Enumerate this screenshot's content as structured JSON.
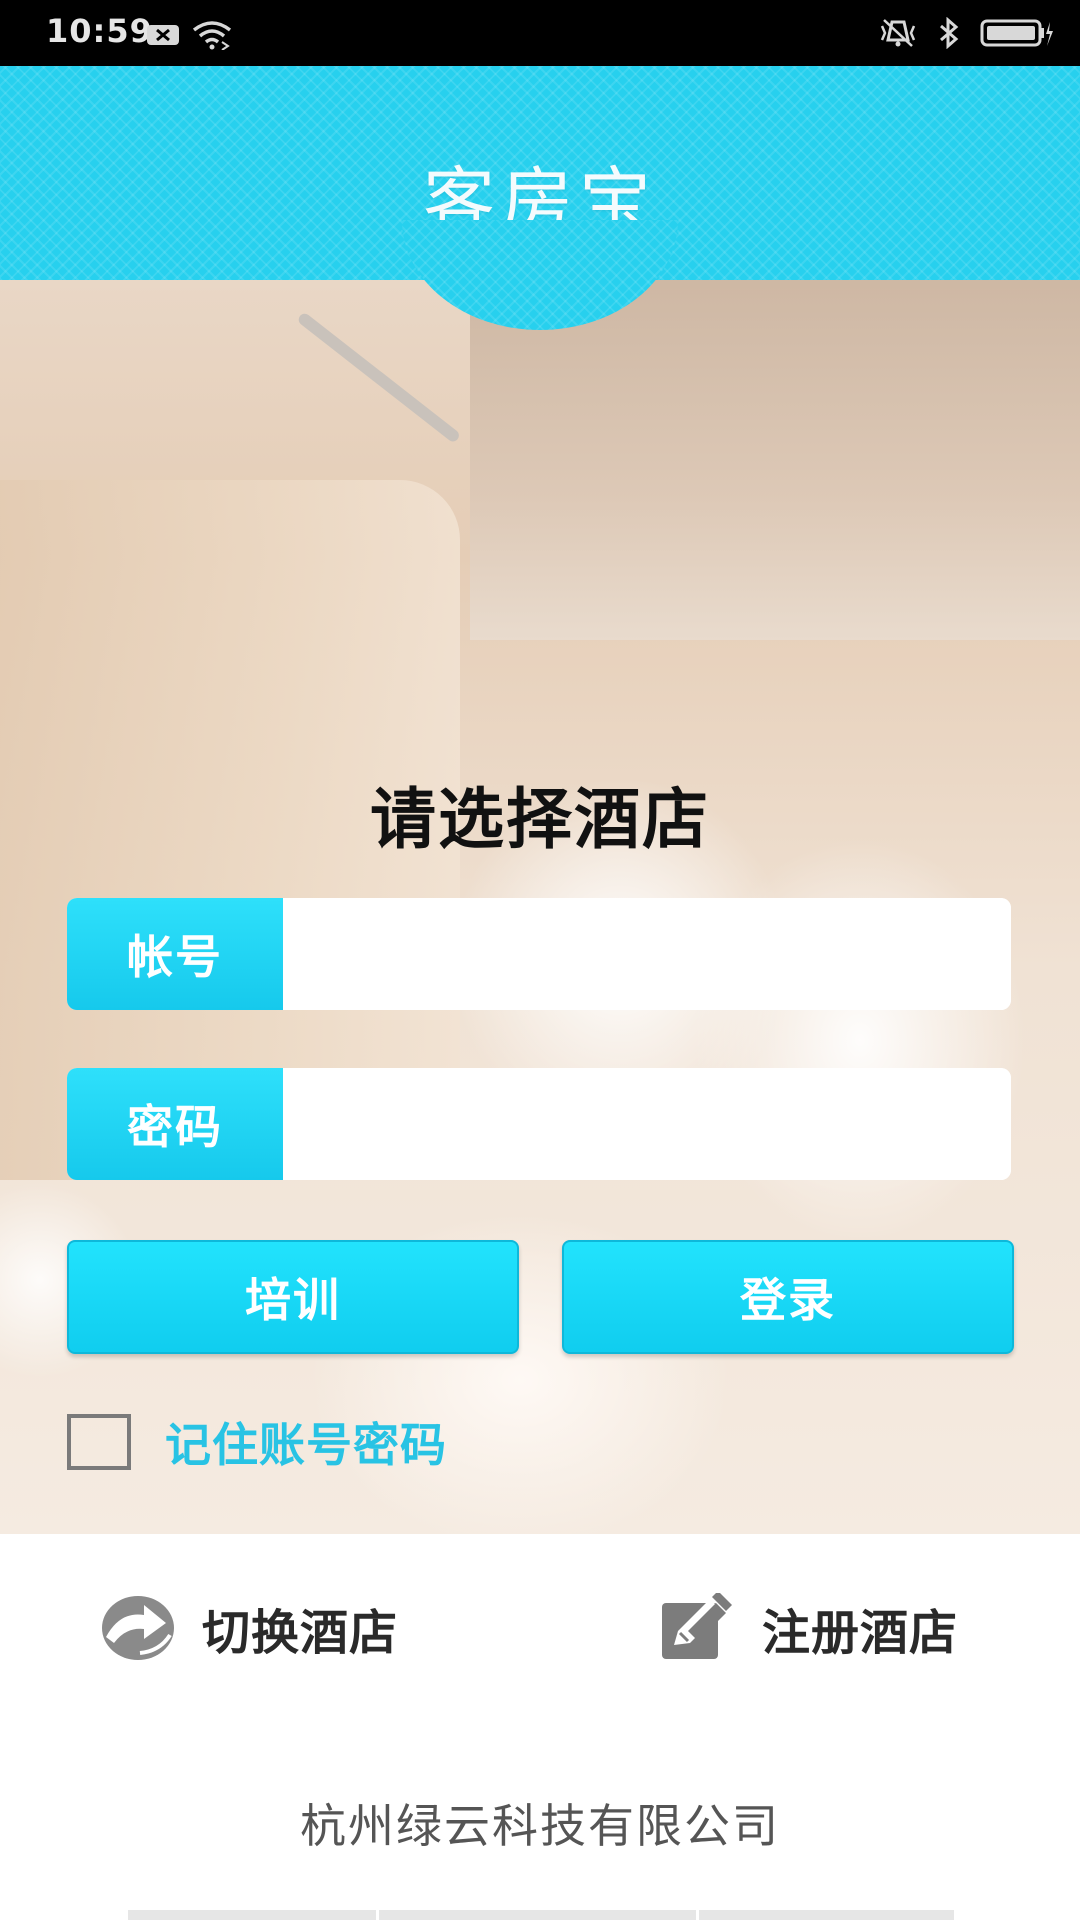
{
  "status_bar": {
    "time": "10:59",
    "left_icons": [
      "notification-x-icon",
      "wifi-icon"
    ],
    "right_icons": [
      "vibrate-icon",
      "bluetooth-icon",
      "battery-charging-icon"
    ]
  },
  "header": {
    "title": "客房宝"
  },
  "form": {
    "title": "请选择酒店",
    "account_label": "帐号",
    "account_value": "",
    "password_label": "密码",
    "password_value": "",
    "train_button": "培训",
    "login_button": "登录",
    "remember_label": "记住账号密码",
    "remember_checked": false
  },
  "actions": {
    "switch_hotel": "切换酒店",
    "register_hotel": "注册酒店"
  },
  "footer": {
    "company": "杭州绿云科技有限公司"
  },
  "colors": {
    "accent": "#27d0ee",
    "button": "#16d0f0",
    "remember_text": "#28c3e4"
  }
}
